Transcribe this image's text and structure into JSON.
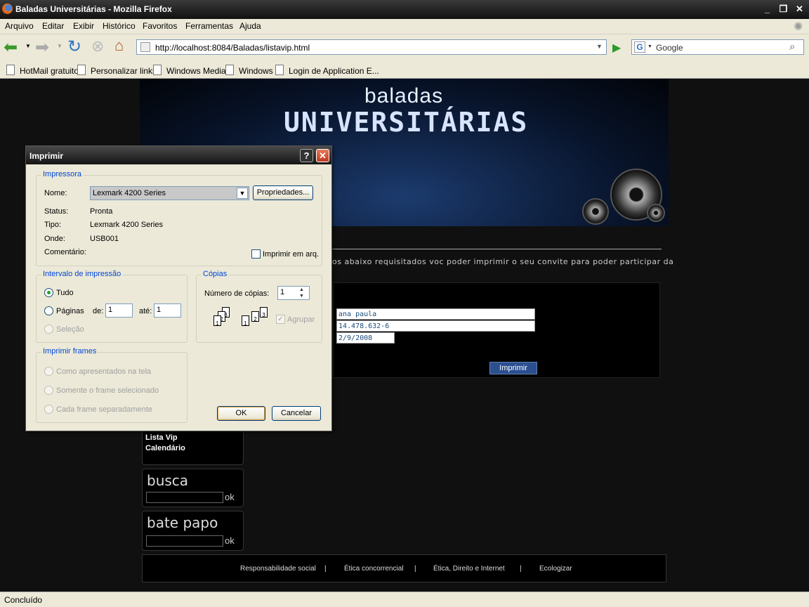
{
  "window": {
    "title": "Baladas Universitárias - Mozilla Firefox",
    "controls": {
      "minimize": "_",
      "restore": "❐",
      "close": "✕"
    }
  },
  "menu": [
    "Arquivo",
    "Editar",
    "Exibir",
    "Histórico",
    "Favoritos",
    "Ferramentas",
    "Ajuda"
  ],
  "nav": {
    "url": "http://localhost:8084/Baladas/listavip.html",
    "search_placeholder": "Google"
  },
  "bookmarks": [
    "HotMail gratuito",
    "Personalizar links",
    "Windows Media",
    "Windows",
    "Login de Application E..."
  ],
  "page": {
    "banner_line1": "baladas",
    "banner_line2": "UNIVERSITÁRIAS",
    "intro_text": "os abaixo requisitados voc poder imprimir o seu convite para poder participar da",
    "form": {
      "name": "ana paula",
      "id": "14.478.632-6",
      "date": "2/9/2008",
      "print_button": "Imprimir"
    },
    "side_menu": [
      "Lista Vip",
      "Calendário"
    ],
    "busca": {
      "title": "busca",
      "ok": "ok"
    },
    "bate_papo": {
      "title": "bate papo",
      "ok": "ok"
    },
    "footer_links": [
      "Responsabilidade social",
      "Ética concorrencial",
      "Ética, Direito e Internet",
      "Ecologizar"
    ],
    "footer_separator": "|"
  },
  "status": "Concluído",
  "dialog": {
    "title": "Imprimir",
    "help": "?",
    "close": "✕",
    "printer": {
      "legend": "Impressora",
      "name_label": "Nome:",
      "name_value": "Lexmark 4200 Series",
      "properties_button": "Propriedades...",
      "status_label": "Status:",
      "status_value": "Pronta",
      "type_label": "Tipo:",
      "type_value": "Lexmark 4200 Series",
      "where_label": "Onde:",
      "where_value": "USB001",
      "comment_label": "Comentário:",
      "print_to_file": "Imprimir em arq."
    },
    "range": {
      "legend": "Intervalo de impressão",
      "all": "Tudo",
      "pages": "Páginas",
      "from_label": "de:",
      "from_value": "1",
      "to_label": "até:",
      "to_value": "1",
      "selection": "Seleção"
    },
    "copies": {
      "legend": "Cópias",
      "count_label": "Número de cópias:",
      "count_value": "1",
      "collate": "Agrupar"
    },
    "frames": {
      "legend": "Imprimir frames",
      "opt1": "Como apresentados na tela",
      "opt2": "Somente o frame selecionado",
      "opt3": "Cada frame separadamente"
    },
    "ok": "OK",
    "cancel": "Cancelar"
  }
}
